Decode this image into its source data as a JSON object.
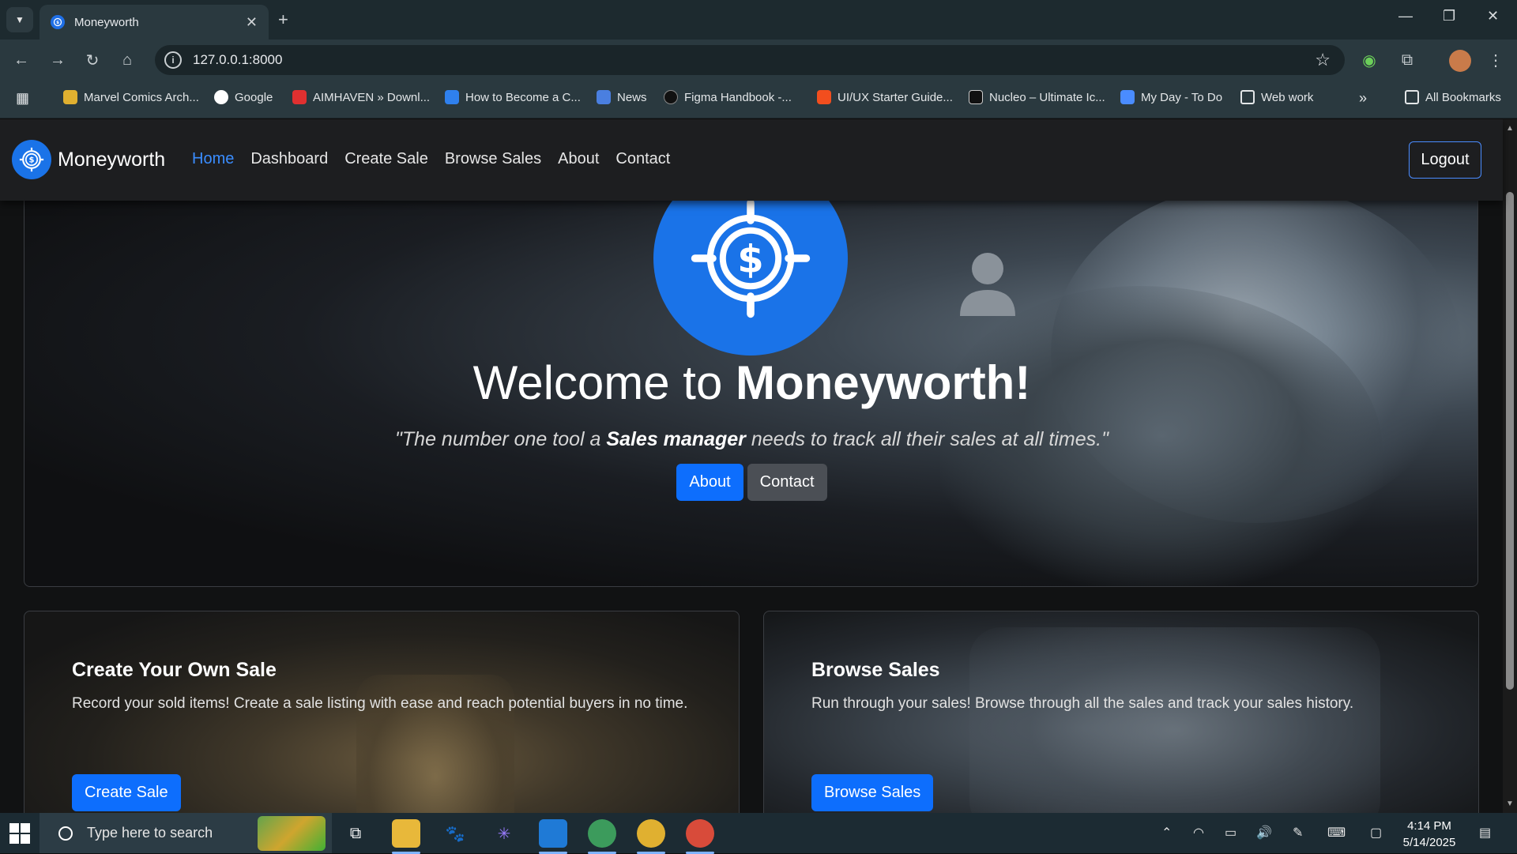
{
  "browser": {
    "tab_title": "Moneyworth",
    "url": "127.0.0.1:8000",
    "bookmarks": [
      {
        "label": "Marvel Comics Arch...",
        "color": "#e0b030"
      },
      {
        "label": "Google",
        "color": "#ffffff"
      },
      {
        "label": "AIMHAVEN » Downl...",
        "color": "#e03030"
      },
      {
        "label": "How to Become a C...",
        "color": "#2f80ed"
      },
      {
        "label": "News",
        "color": "#4a7fe0"
      },
      {
        "label": "Figma Handbook -...",
        "color": "#111111"
      },
      {
        "label": "UI/UX Starter Guide...",
        "color": "#f24e1e"
      },
      {
        "label": "Nucleo – Ultimate Ic...",
        "color": "#111111"
      },
      {
        "label": "My Day - To Do",
        "color": "#4a8cff"
      },
      {
        "label": "Web work",
        "color": "folder"
      }
    ],
    "all_bookmarks": "All Bookmarks",
    "overflow": "»"
  },
  "site": {
    "brand": "Moneyworth",
    "nav": [
      "Home",
      "Dashboard",
      "Create Sale",
      "Browse Sales",
      "About",
      "Contact"
    ],
    "logout": "Logout",
    "accent": "#0d6efd"
  },
  "hero": {
    "title_prefix": "Welcome to ",
    "title_brand": "Moneyworth!",
    "subtitle_pre": "\"The number one tool a ",
    "subtitle_bold": "Sales manager",
    "subtitle_post": " needs to track all their sales at all times.\"",
    "btn_about": "About",
    "btn_contact": "Contact"
  },
  "cards": [
    {
      "title": "Create Your Own Sale",
      "text": "Record your sold items! Create a sale listing with ease and reach potential buyers in no time.",
      "button": "Create Sale"
    },
    {
      "title": "Browse Sales",
      "text": "Run through your sales! Browse through all the sales and track your sales history.",
      "button": "Browse Sales"
    }
  ],
  "taskbar": {
    "search_placeholder": "Type here to search",
    "time": "4:14 PM",
    "date": "5/14/2025"
  }
}
